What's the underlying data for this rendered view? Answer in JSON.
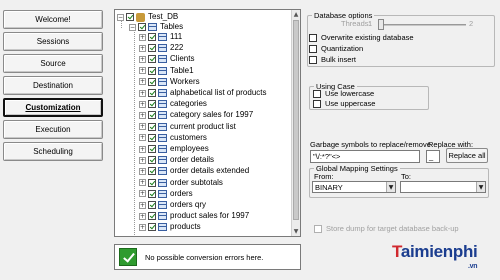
{
  "nav": {
    "items": [
      {
        "label": "Welcome!",
        "active": false
      },
      {
        "label": "Sessions",
        "active": false
      },
      {
        "label": "Source",
        "active": false
      },
      {
        "label": "Destination",
        "active": false
      },
      {
        "label": "Customization",
        "active": true
      },
      {
        "label": "Execution",
        "active": false
      },
      {
        "label": "Scheduling",
        "active": false
      }
    ]
  },
  "tree": {
    "db_label": "Test_DB",
    "tables_label": "Tables",
    "items": [
      "111",
      "222",
      "Clients",
      "Table1",
      "Workers",
      "alphabetical list of products",
      "categories",
      "category sales for 1997",
      "current product list",
      "customers",
      "employees",
      "order details",
      "order details extended",
      "order subtotals",
      "orders",
      "orders qry",
      "product sales for 1997",
      "products"
    ]
  },
  "options": {
    "database_title": "Database options",
    "threads_label": "Threads:",
    "threads_min": "1",
    "threads_max": "2",
    "threads_fraction": 0.0,
    "overwrite_label": "Overwrite existing database",
    "quantization_label": "Quantization",
    "bulk_insert_label": "Bulk insert",
    "using_case_title": "Using Case",
    "lowercase_label": "Use lowercase",
    "uppercase_label": "Use uppercase",
    "garbage_label": "Garbage symbols to replace/remove",
    "garbage_value": "\"\\/:*?\"<>",
    "replace_with_label": "Replace with:",
    "replace_with_value": "_",
    "replace_all_label": "Replace all",
    "global_mapping_title": "Global Mapping Settings",
    "from_label": "From:",
    "to_label": "To:",
    "from_value": "BINARY",
    "to_value": "",
    "store_dump_label": "Store dump for target database back-up"
  },
  "status": {
    "message": "No possible conversion errors here."
  },
  "watermark": {
    "brand_t": "T",
    "brand_rest": "aimienphi",
    "domain": ".vn"
  },
  "colors": {
    "status_ok": "#2f9b2f",
    "brand_red": "#d0282e",
    "brand_blue": "#1b3d8f"
  }
}
